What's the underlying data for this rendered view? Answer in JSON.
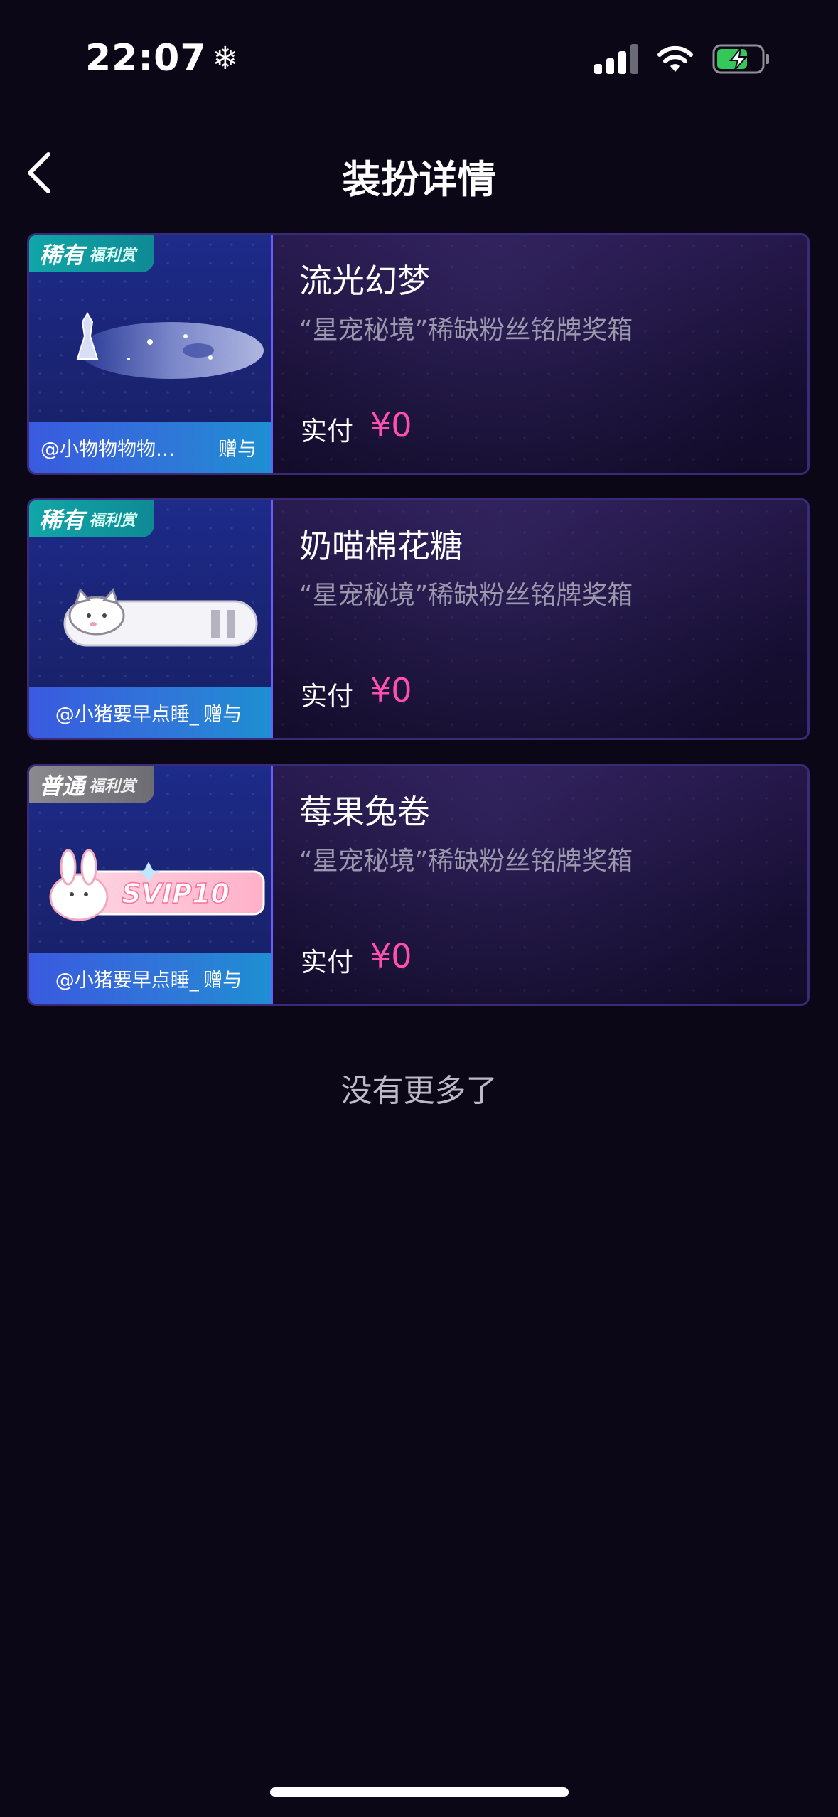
{
  "status_bar": {
    "time": "22:07",
    "snow_icon": "❄",
    "signal_icon": "cellular-signal-icon",
    "wifi_icon": "wifi-icon",
    "battery_icon": "battery-charging-icon",
    "battery_color": "#34c759"
  },
  "nav": {
    "back_icon": "chevron-left-icon",
    "title": "装扮详情"
  },
  "items": [
    {
      "name": "流光幻梦",
      "source": "“星宠秘境”稀缺粉丝铭牌奖箱",
      "pay_label": "实付",
      "pay_value": "¥0",
      "badge_main": "稀有",
      "badge_sub": "福利赏",
      "badge_color": "#11a6a8",
      "gift_user": "@小物物物物…",
      "gift_action": "赠与"
    },
    {
      "name": "奶喵棉花糖",
      "source": "“星宠秘境”稀缺粉丝铭牌奖箱",
      "pay_label": "实付",
      "pay_value": "¥0",
      "badge_main": "稀有",
      "badge_sub": "福利赏",
      "badge_color": "#11a6a8",
      "gift_user": "@小猪要早点睡_",
      "gift_action": "赠与"
    },
    {
      "name": "莓果兔卷",
      "source": "“星宠秘境”稀缺粉丝铭牌奖箱",
      "pay_label": "实付",
      "pay_value": "¥0",
      "badge_main": "普通",
      "badge_sub": "福利赏",
      "badge_color": "#8a8a8e",
      "gift_user": "@小猪要早点睡_",
      "gift_action": "赠与",
      "plate_text": "SVIP10"
    }
  ],
  "footer": {
    "no_more": "没有更多了"
  },
  "colors": {
    "background": "#0b0717",
    "price": "#ff4fb0",
    "accent": "#6a5cff"
  }
}
